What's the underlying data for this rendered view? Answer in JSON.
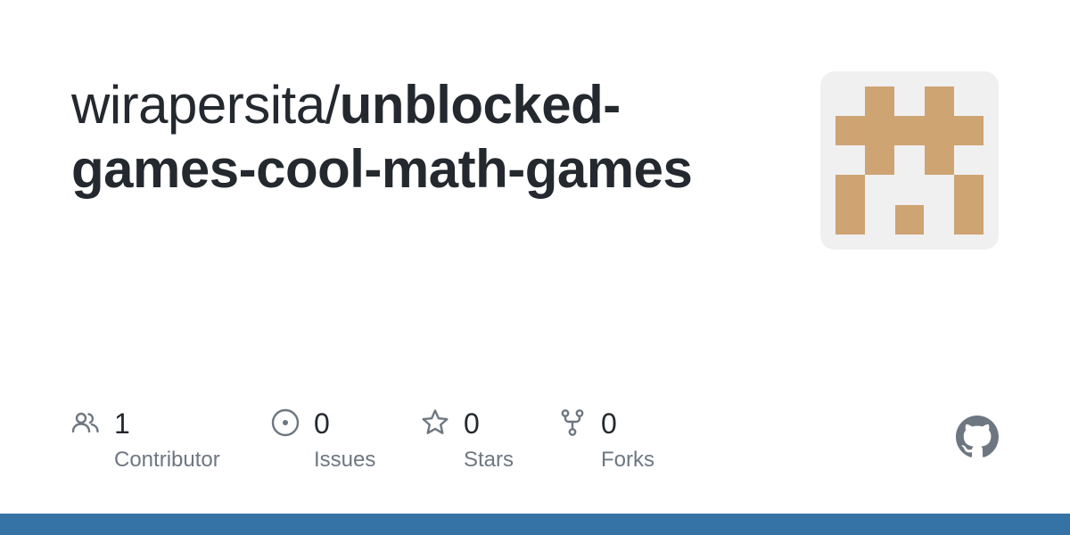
{
  "repo": {
    "owner_prefix": "wirapersita/",
    "name": "unblocked-games-cool-math-games"
  },
  "stats": {
    "contributors": {
      "count": "1",
      "label": "Contributor",
      "icon": "people-icon"
    },
    "issues": {
      "count": "0",
      "label": "Issues",
      "icon": "issue-opened-icon"
    },
    "stars": {
      "count": "0",
      "label": "Stars",
      "icon": "star-icon"
    },
    "forks": {
      "count": "0",
      "label": "Forks",
      "icon": "repo-forked-icon"
    }
  },
  "identicon": {
    "color": "#cea472",
    "background": "#f0f0f0",
    "icon": "identicon-avatar"
  },
  "branding": {
    "logo": "github-mark-icon",
    "language_bar_color": "#3572a5"
  },
  "colors": {
    "text_primary": "#24292f",
    "text_secondary": "#6e7781",
    "icon_gray": "#6e7781"
  }
}
